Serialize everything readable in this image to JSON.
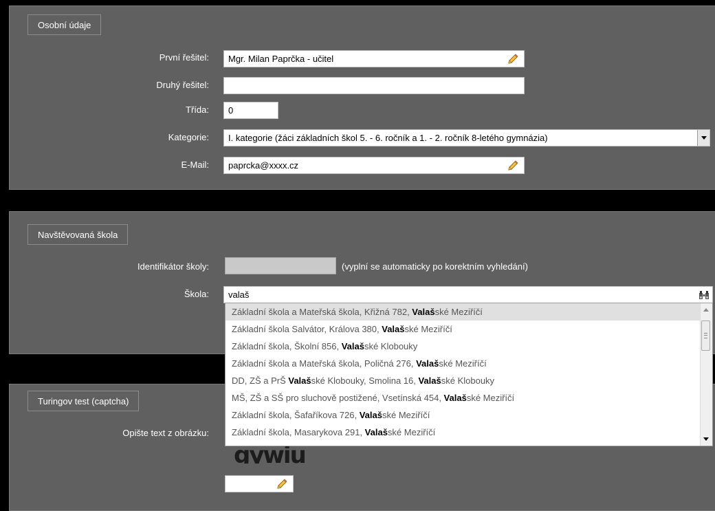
{
  "osobni": {
    "legend": "Osobní údaje",
    "prvni_label": "První řešitel:",
    "prvni_value": "Mgr. Milan Paprčka - učitel",
    "druhy_label": "Druhý řešitel:",
    "druhy_value": "",
    "trida_label": "Třída:",
    "trida_value": "0",
    "kategorie_label": "Kategorie:",
    "kategorie_value": "I. kategorie (žáci základních škol 5. - 6. ročník a 1. - 2. ročník 8-letého gymnázia)",
    "email_label": "E-Mail:",
    "email_value": "paprcka@xxxx.cz"
  },
  "skola": {
    "legend": "Navštěvovaná škola",
    "id_label": "Identifikátor školy:",
    "id_value": "",
    "id_hint": "(vyplní se automaticky po korektním vyhledání)",
    "skola_label": "Škola:",
    "skola_value": "valaš"
  },
  "autocomplete": {
    "items": [
      {
        "pre": "Základní škola a Mateřská škola, Křižná 782, ",
        "match": "Vala",
        "mid": "š",
        "post": "ské Meziříčí",
        "highlighted": true
      },
      {
        "pre": "Základní škola Salvátor, Králova 380, ",
        "match": "Vala",
        "mid": "š",
        "post": "ské Meziříčí"
      },
      {
        "pre": "Základní škola, Školní 856, ",
        "match": "Vala",
        "mid": "š",
        "post": "ské Klobouky"
      },
      {
        "pre": "Základní škola a Mateřská škola, Poličná 276, ",
        "match": "Vala",
        "mid": "š",
        "post": "ské Meziříčí"
      },
      {
        "pre": "DD, ZŠ a PrŠ ",
        "match": "Vala",
        "mid": "š",
        "post": "ské Klobouky, Smolina 16, ",
        "match2": "Vala",
        "mid2": "š",
        "post2": "ské Klobouky"
      },
      {
        "pre": "MŠ, ZŠ a SŠ pro sluchově postižené, Vsetínská 454, ",
        "match": "Vala",
        "mid": "š",
        "post": "ské Meziříčí"
      },
      {
        "pre": "Základní škola, Šafaříkova 726, ",
        "match": "Vala",
        "mid": "š",
        "post": "ské Meziříčí"
      },
      {
        "pre": "Základní škola, Masarykova 291, ",
        "match": "Vala",
        "mid": "š",
        "post": "ské Meziříčí"
      }
    ]
  },
  "captcha": {
    "legend": "Turingov test (captcha)",
    "label": "Opište text z obrázku:",
    "image_text": "gywiu",
    "value": ""
  },
  "icons": {
    "pencil": "pencil-icon",
    "search": "binoculars-icon"
  }
}
